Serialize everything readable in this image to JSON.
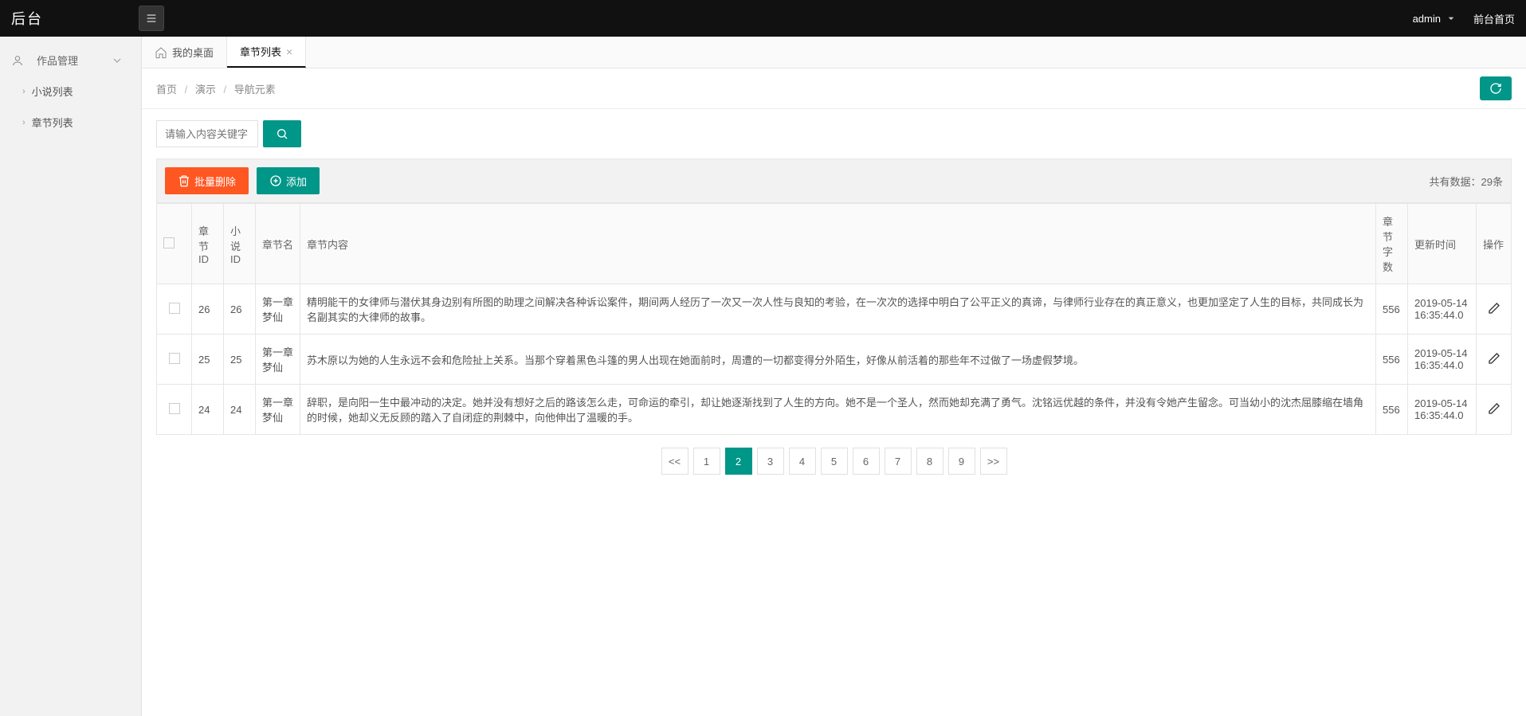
{
  "topbar": {
    "logo": "后台",
    "user": "admin",
    "front_link": "前台首页"
  },
  "sidebar": {
    "parent": {
      "label": "作品管理"
    },
    "children": [
      {
        "label": "小说列表"
      },
      {
        "label": "章节列表"
      }
    ]
  },
  "tabs": [
    {
      "label": "我的桌面",
      "closable": false,
      "active": false
    },
    {
      "label": "章节列表",
      "closable": true,
      "active": true
    }
  ],
  "breadcrumb": {
    "items": [
      "首页",
      "演示",
      "导航元素"
    ]
  },
  "search": {
    "placeholder": "请输入内容关键字"
  },
  "toolbar": {
    "delete_label": "批量删除",
    "add_label": "添加",
    "count_prefix": "共有数据：",
    "count_value": "29条"
  },
  "table": {
    "headers": {
      "chapter_id": "章节ID",
      "novel_id": "小说ID",
      "chapter_name": "章节名",
      "chapter_content": "章节内容",
      "word_count": "章节字数",
      "update_time": "更新时间",
      "operate": "操作"
    },
    "rows": [
      {
        "chapter_id": "26",
        "novel_id": "26",
        "chapter_name": "第一章 梦仙",
        "chapter_content": "精明能干的女律师与潜伏其身边别有所图的助理之间解决各种诉讼案件，期间两人经历了一次又一次人性与良知的考验，在一次次的选择中明白了公平正义的真谛，与律师行业存在的真正意义，也更加坚定了人生的目标，共同成长为名副其实的大律师的故事。",
        "word_count": "556",
        "update_time": "2019-05-14 16:35:44.0"
      },
      {
        "chapter_id": "25",
        "novel_id": "25",
        "chapter_name": "第一章 梦仙",
        "chapter_content": "苏木原以为她的人生永远不会和危险扯上关系。当那个穿着黑色斗篷的男人出现在她面前时，周遭的一切都变得分外陌生，好像从前活着的那些年不过做了一场虚假梦境。",
        "word_count": "556",
        "update_time": "2019-05-14 16:35:44.0"
      },
      {
        "chapter_id": "24",
        "novel_id": "24",
        "chapter_name": "第一章 梦仙",
        "chapter_content": "辞职，是向阳一生中最冲动的决定。她并没有想好之后的路该怎么走，可命运的牵引，却让她逐渐找到了人生的方向。她不是一个圣人，然而她却充满了勇气。沈铭远优越的条件，并没有令她产生留念。可当幼小的沈杰屈膝缩在墙角的时候，她却义无反顾的踏入了自闭症的荆棘中，向他伸出了温暖的手。",
        "word_count": "556",
        "update_time": "2019-05-14 16:35:44.0"
      }
    ]
  },
  "pagination": {
    "prev": "<<",
    "next": ">>",
    "pages": [
      "1",
      "2",
      "3",
      "4",
      "5",
      "6",
      "7",
      "8",
      "9"
    ],
    "active": 2
  }
}
